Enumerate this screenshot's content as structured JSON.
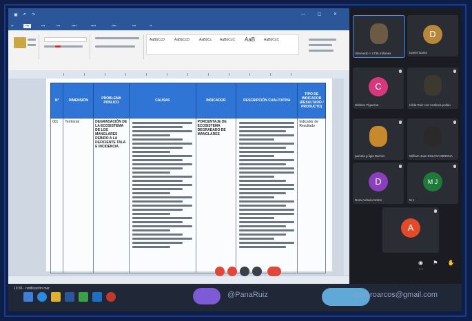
{
  "taskbar": {
    "left_label": "10:36 · notificación mar",
    "watermark_left": "@PanaRuiz",
    "watermark_right": "romeroarcos@gmail.com"
  },
  "table": {
    "headers": [
      "N°",
      "DIMENSIÓN",
      "PROBLEMA PÚBLICO",
      "CAUSAS",
      "INDICADOR",
      "DESCRIPCIÓN CUALITATIVA",
      "TIPO DE INDICADOR (RESULTADO / PRODUCTO)"
    ],
    "row1": {
      "num": "001",
      "dimension": "Territorial",
      "problema": "DEGRADACIÓN DE LA ECOSISTEMA DE LOS MANGLARES DEBIDO A LA DEFICIENTE TALA E INCIDENCIA",
      "indicador": "PORCENTAJE DE ECOSISTEMA DEGRADADO DE MANGLARES",
      "tipo": "Indicador de Resultado"
    }
  },
  "participants": [
    {
      "name": "Bernardo + 1735 millones",
      "initial": "",
      "color": "#6b5a44"
    },
    {
      "name": "Daniel Dante",
      "initial": "D",
      "color": "#b8883a"
    },
    {
      "name": "Gildees Figueroa",
      "initial": "C",
      "color": "#d6377d"
    },
    {
      "name": "Hilda Ruiz con Anafoca pollao",
      "initial": "",
      "color": "#3c3a2e"
    },
    {
      "name": "pamela g ligia Barrios",
      "initial": "",
      "color": "#c68a2c"
    },
    {
      "name": "William Juan ESLOVA MEDINA",
      "initial": "",
      "color": "#2c2a28"
    },
    {
      "name": "Dora Anfavia Nobre",
      "initial": "D",
      "color": "#8a3fbf"
    },
    {
      "name": "M J",
      "initial": "M J",
      "color": "#1f7a3a"
    }
  ],
  "presenter": {
    "initial": "A",
    "color": "#e24a2a"
  },
  "colors": {
    "word_blue": "#2b579a",
    "table_header": "#2e75d6",
    "taskbar": "#202736"
  }
}
